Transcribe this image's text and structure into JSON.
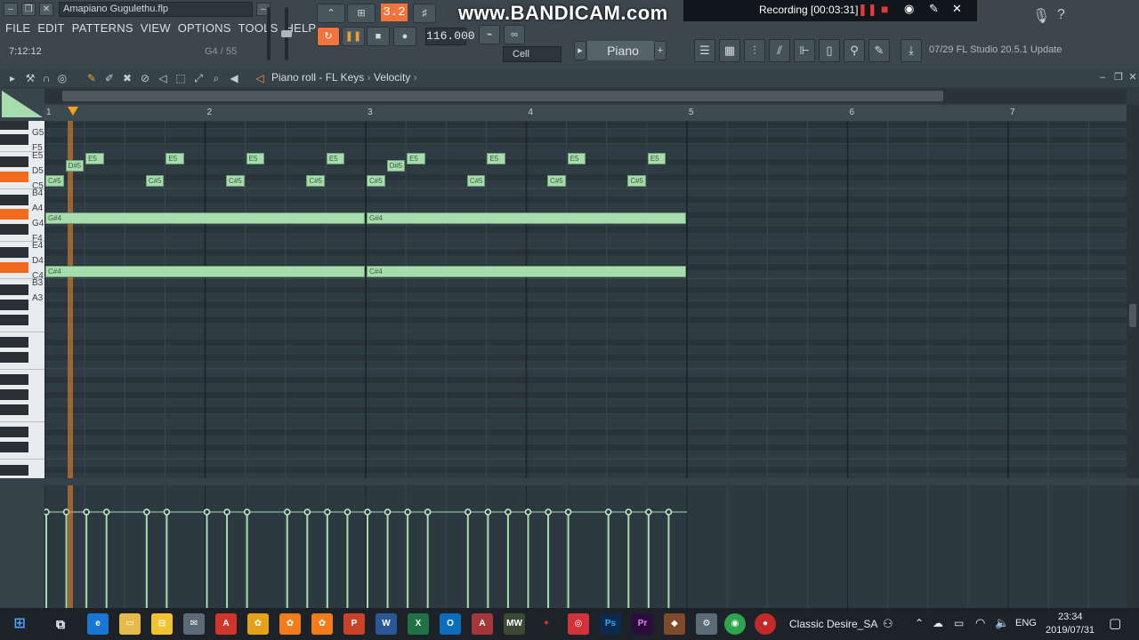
{
  "window": {
    "file_name": "Amapiano Gugulethu.flp"
  },
  "menu": [
    "FILE",
    "EDIT",
    "PATTERNS",
    "VIEW",
    "OPTIONS",
    "TOOLS",
    "HELP"
  ],
  "readouts": {
    "time": "7:12:12",
    "position": "G4 / 55"
  },
  "transport": {
    "pattern_number": "3.2",
    "tempo": "116.000",
    "snap": "Cell",
    "channel": "Piano"
  },
  "overlay": {
    "watermark": "www.BANDICAM.com",
    "recording": "Recording [00:03:31]"
  },
  "update": {
    "text": "07/29  FL Studio 20.5.1 Update"
  },
  "piano_roll": {
    "breadcrumb": [
      "Piano roll - FL Keys",
      "Velocity"
    ],
    "bar_numbers": [
      "1",
      "2",
      "3",
      "4",
      "5",
      "6",
      "7"
    ],
    "key_labels": [
      "G5",
      "F5",
      "E5",
      "D5",
      "C5",
      "B4",
      "A4",
      "G4",
      "F4",
      "E4",
      "D4",
      "C4",
      "B3",
      "A3"
    ],
    "notes": [
      {
        "pitch": "E5",
        "label": "E5",
        "start": 0.25,
        "len": 0.125
      },
      {
        "pitch": "E5",
        "label": "E5",
        "start": 0.75,
        "len": 0.125
      },
      {
        "pitch": "E5",
        "label": "E5",
        "start": 1.25,
        "len": 0.125
      },
      {
        "pitch": "E5",
        "label": "E5",
        "start": 1.75,
        "len": 0.125
      },
      {
        "pitch": "E5",
        "label": "E5",
        "start": 2.25,
        "len": 0.125
      },
      {
        "pitch": "E5",
        "label": "E5",
        "start": 2.75,
        "len": 0.125
      },
      {
        "pitch": "E5",
        "label": "E5",
        "start": 3.25,
        "len": 0.125
      },
      {
        "pitch": "E5",
        "label": "E5",
        "start": 3.75,
        "len": 0.125
      },
      {
        "pitch": "D#5",
        "label": "D#5",
        "start": 0.125,
        "len": 0.125
      },
      {
        "pitch": "D#5",
        "label": "D#5",
        "start": 2.125,
        "len": 0.125
      },
      {
        "pitch": "C#5",
        "label": "C#5",
        "start": 0.0,
        "len": 0.125
      },
      {
        "pitch": "C#5",
        "label": "C#5",
        "start": 0.625,
        "len": 0.125
      },
      {
        "pitch": "C#5",
        "label": "C#5",
        "start": 1.125,
        "len": 0.125
      },
      {
        "pitch": "C#5",
        "label": "C#5",
        "start": 1.625,
        "len": 0.125
      },
      {
        "pitch": "C#5",
        "label": "C#5",
        "start": 2.0,
        "len": 0.125
      },
      {
        "pitch": "C#5",
        "label": "C#5",
        "start": 2.625,
        "len": 0.125
      },
      {
        "pitch": "C#5",
        "label": "C#5",
        "start": 3.125,
        "len": 0.125
      },
      {
        "pitch": "C#5",
        "label": "C#5",
        "start": 3.625,
        "len": 0.125
      },
      {
        "pitch": "G#4",
        "label": "G#4",
        "start": 0.0,
        "len": 2.0
      },
      {
        "pitch": "G#4",
        "label": "G#4",
        "start": 2.0,
        "len": 2.0
      },
      {
        "pitch": "C#4",
        "label": "C#4",
        "start": 0.0,
        "len": 2.0
      },
      {
        "pitch": "C#4",
        "label": "C#4",
        "start": 2.0,
        "len": 2.0
      }
    ],
    "velocity_ticks_beats": [
      0,
      0.125,
      0.25,
      0.375,
      0.625,
      0.75,
      1.0,
      1.125,
      1.25,
      1.5,
      1.625,
      1.75,
      1.875,
      2.0,
      2.125,
      2.25,
      2.375,
      2.625,
      2.75,
      2.875,
      3.0,
      3.125,
      3.25,
      3.5,
      3.625,
      3.75,
      3.875
    ]
  },
  "taskbar": {
    "user": "Classic Desire_SA",
    "lang": "ENG",
    "time": "23:34",
    "date": "2019/07/31"
  },
  "colors": {
    "accent": "#f26a1b",
    "note": "#a6dcae",
    "grid_bg": "#2d3940"
  }
}
